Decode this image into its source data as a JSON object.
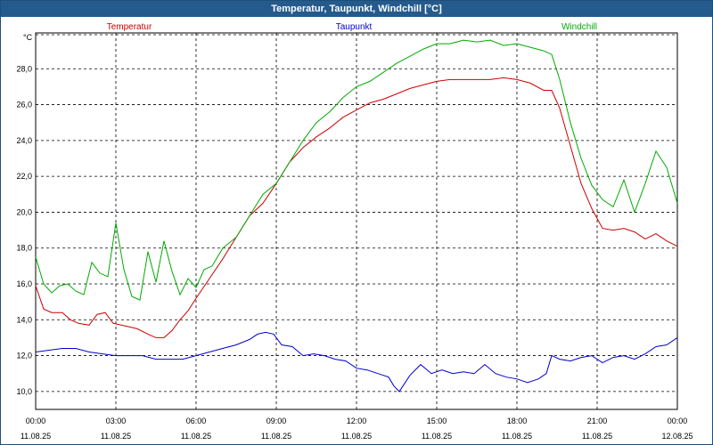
{
  "window": {
    "title": "Temperatur, Taupunkt, Windchill [°C]"
  },
  "chart_data": {
    "type": "line",
    "title": "Temperatur, Taupunkt, Windchill [°C]",
    "ylabel": "°C",
    "ylim": [
      9,
      30
    ],
    "yticks": [
      "10,0",
      "12,0",
      "14,0",
      "16,0",
      "18,0",
      "20,0",
      "22,0",
      "24,0",
      "26,0",
      "28,0"
    ],
    "xticks": [
      {
        "time": "00:00",
        "date": "11.08.25"
      },
      {
        "time": "03:00",
        "date": "11.08.25"
      },
      {
        "time": "06:00",
        "date": "11.08.25"
      },
      {
        "time": "09:00",
        "date": "11.08.25"
      },
      {
        "time": "12:00",
        "date": "11.08.25"
      },
      {
        "time": "15:00",
        "date": "11.08.25"
      },
      {
        "time": "18:00",
        "date": "11.08.25"
      },
      {
        "time": "21:00",
        "date": "11.08.25"
      },
      {
        "time": "00:00",
        "date": "12.08.25"
      }
    ],
    "xlim_hours": [
      0,
      24
    ],
    "grid": true,
    "legend_position": "top",
    "series": [
      {
        "name": "Temperatur",
        "color": "#cc0000",
        "x": [
          0,
          0.3,
          0.6,
          1.0,
          1.3,
          1.6,
          2.0,
          2.3,
          2.6,
          2.9,
          3.2,
          3.5,
          3.8,
          4.2,
          4.5,
          4.8,
          5.1,
          5.4,
          5.7,
          6.0,
          6.5,
          7.0,
          7.5,
          8.0,
          8.5,
          9.0,
          9.5,
          10.0,
          10.5,
          11.0,
          11.5,
          12.0,
          12.5,
          13.0,
          13.5,
          14.0,
          14.5,
          15.0,
          15.5,
          16.0,
          16.5,
          17.0,
          17.5,
          18.0,
          18.5,
          19.0,
          19.3,
          19.6,
          20.0,
          20.4,
          20.8,
          21.2,
          21.6,
          22.0,
          22.4,
          22.8,
          23.2,
          23.6,
          24.0
        ],
        "values": [
          15.9,
          14.6,
          14.4,
          14.4,
          14.0,
          13.8,
          13.7,
          14.3,
          14.4,
          13.8,
          13.7,
          13.6,
          13.5,
          13.2,
          13.0,
          13.0,
          13.4,
          14.0,
          14.5,
          15.2,
          16.3,
          17.4,
          18.6,
          19.8,
          20.5,
          21.6,
          22.8,
          23.6,
          24.2,
          24.7,
          25.3,
          25.7,
          26.1,
          26.3,
          26.6,
          26.9,
          27.1,
          27.3,
          27.4,
          27.4,
          27.4,
          27.4,
          27.5,
          27.4,
          27.2,
          26.8,
          26.8,
          25.8,
          23.7,
          21.6,
          20.2,
          19.1,
          19.0,
          19.1,
          18.9,
          18.5,
          18.8,
          18.4,
          18.1
        ]
      },
      {
        "name": "Taupunkt",
        "color": "#0000cc",
        "x": [
          0,
          0.5,
          1.0,
          1.5,
          2.0,
          2.5,
          3.0,
          3.5,
          4.0,
          4.5,
          5.0,
          5.5,
          6.0,
          6.5,
          7.0,
          7.5,
          8.0,
          8.3,
          8.6,
          8.9,
          9.2,
          9.6,
          10.0,
          10.4,
          10.8,
          11.2,
          11.6,
          12.0,
          12.4,
          12.8,
          13.2,
          13.4,
          13.6,
          14.0,
          14.4,
          14.8,
          15.2,
          15.6,
          16.0,
          16.4,
          16.8,
          17.2,
          17.6,
          18.0,
          18.4,
          18.8,
          19.1,
          19.3,
          19.6,
          20.0,
          20.4,
          20.8,
          21.2,
          21.6,
          22.0,
          22.4,
          22.8,
          23.2,
          23.6,
          24.0
        ],
        "values": [
          12.2,
          12.3,
          12.4,
          12.4,
          12.2,
          12.1,
          12.0,
          12.0,
          12.0,
          11.8,
          11.8,
          11.8,
          12.0,
          12.2,
          12.4,
          12.6,
          12.9,
          13.2,
          13.3,
          13.2,
          12.6,
          12.5,
          12.0,
          12.1,
          12.0,
          11.8,
          11.7,
          11.3,
          11.2,
          11.0,
          10.8,
          10.3,
          10.0,
          10.9,
          11.5,
          11.0,
          11.2,
          11.0,
          11.1,
          11.0,
          11.5,
          11.0,
          10.8,
          10.7,
          10.5,
          10.7,
          11.0,
          12.0,
          11.8,
          11.7,
          11.9,
          12.0,
          11.6,
          11.9,
          12.0,
          11.8,
          12.1,
          12.5,
          12.6,
          13.0
        ]
      },
      {
        "name": "Windchill",
        "color": "#00aa00",
        "x": [
          0,
          0.3,
          0.6,
          0.9,
          1.2,
          1.5,
          1.8,
          2.1,
          2.4,
          2.7,
          3.0,
          3.3,
          3.6,
          3.9,
          4.2,
          4.5,
          4.8,
          5.1,
          5.4,
          5.7,
          6.0,
          6.3,
          6.6,
          7.0,
          7.5,
          8.0,
          8.5,
          9.0,
          9.5,
          10.0,
          10.5,
          11.0,
          11.5,
          12.0,
          12.5,
          13.0,
          13.5,
          14.0,
          14.5,
          15.0,
          15.5,
          16.0,
          16.5,
          17.0,
          17.5,
          18.0,
          18.5,
          19.0,
          19.3,
          19.6,
          20.0,
          20.4,
          20.8,
          21.2,
          21.6,
          22.0,
          22.4,
          22.8,
          23.2,
          23.6,
          24.0
        ],
        "values": [
          17.5,
          16.0,
          15.5,
          15.9,
          16.0,
          15.6,
          15.4,
          17.2,
          16.6,
          16.4,
          19.4,
          16.8,
          15.3,
          15.1,
          17.8,
          16.1,
          18.4,
          16.7,
          15.4,
          16.3,
          15.8,
          16.8,
          17.0,
          18.0,
          18.6,
          19.8,
          21.0,
          21.6,
          22.8,
          24.0,
          25.0,
          25.6,
          26.4,
          27.0,
          27.3,
          27.8,
          28.3,
          28.7,
          29.1,
          29.4,
          29.4,
          29.6,
          29.5,
          29.6,
          29.3,
          29.4,
          29.2,
          29.0,
          28.8,
          27.4,
          25.0,
          23.0,
          21.5,
          20.7,
          20.3,
          21.8,
          20.0,
          21.6,
          23.4,
          22.5,
          20.5
        ]
      }
    ]
  }
}
